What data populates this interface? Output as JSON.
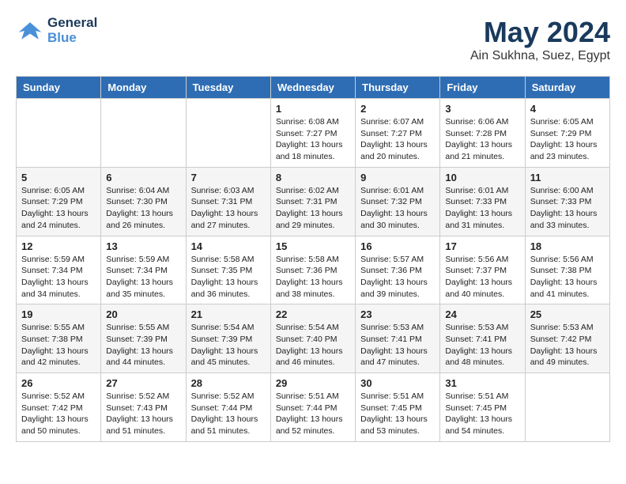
{
  "header": {
    "logo_general": "General",
    "logo_blue": "Blue",
    "title": "May 2024",
    "subtitle": "Ain Sukhna, Suez, Egypt"
  },
  "weekdays": [
    "Sunday",
    "Monday",
    "Tuesday",
    "Wednesday",
    "Thursday",
    "Friday",
    "Saturday"
  ],
  "weeks": [
    [
      {
        "day": "",
        "info": ""
      },
      {
        "day": "",
        "info": ""
      },
      {
        "day": "",
        "info": ""
      },
      {
        "day": "1",
        "info": "Sunrise: 6:08 AM\nSunset: 7:27 PM\nDaylight: 13 hours\nand 18 minutes."
      },
      {
        "day": "2",
        "info": "Sunrise: 6:07 AM\nSunset: 7:27 PM\nDaylight: 13 hours\nand 20 minutes."
      },
      {
        "day": "3",
        "info": "Sunrise: 6:06 AM\nSunset: 7:28 PM\nDaylight: 13 hours\nand 21 minutes."
      },
      {
        "day": "4",
        "info": "Sunrise: 6:05 AM\nSunset: 7:29 PM\nDaylight: 13 hours\nand 23 minutes."
      }
    ],
    [
      {
        "day": "5",
        "info": "Sunrise: 6:05 AM\nSunset: 7:29 PM\nDaylight: 13 hours\nand 24 minutes."
      },
      {
        "day": "6",
        "info": "Sunrise: 6:04 AM\nSunset: 7:30 PM\nDaylight: 13 hours\nand 26 minutes."
      },
      {
        "day": "7",
        "info": "Sunrise: 6:03 AM\nSunset: 7:31 PM\nDaylight: 13 hours\nand 27 minutes."
      },
      {
        "day": "8",
        "info": "Sunrise: 6:02 AM\nSunset: 7:31 PM\nDaylight: 13 hours\nand 29 minutes."
      },
      {
        "day": "9",
        "info": "Sunrise: 6:01 AM\nSunset: 7:32 PM\nDaylight: 13 hours\nand 30 minutes."
      },
      {
        "day": "10",
        "info": "Sunrise: 6:01 AM\nSunset: 7:33 PM\nDaylight: 13 hours\nand 31 minutes."
      },
      {
        "day": "11",
        "info": "Sunrise: 6:00 AM\nSunset: 7:33 PM\nDaylight: 13 hours\nand 33 minutes."
      }
    ],
    [
      {
        "day": "12",
        "info": "Sunrise: 5:59 AM\nSunset: 7:34 PM\nDaylight: 13 hours\nand 34 minutes."
      },
      {
        "day": "13",
        "info": "Sunrise: 5:59 AM\nSunset: 7:34 PM\nDaylight: 13 hours\nand 35 minutes."
      },
      {
        "day": "14",
        "info": "Sunrise: 5:58 AM\nSunset: 7:35 PM\nDaylight: 13 hours\nand 36 minutes."
      },
      {
        "day": "15",
        "info": "Sunrise: 5:58 AM\nSunset: 7:36 PM\nDaylight: 13 hours\nand 38 minutes."
      },
      {
        "day": "16",
        "info": "Sunrise: 5:57 AM\nSunset: 7:36 PM\nDaylight: 13 hours\nand 39 minutes."
      },
      {
        "day": "17",
        "info": "Sunrise: 5:56 AM\nSunset: 7:37 PM\nDaylight: 13 hours\nand 40 minutes."
      },
      {
        "day": "18",
        "info": "Sunrise: 5:56 AM\nSunset: 7:38 PM\nDaylight: 13 hours\nand 41 minutes."
      }
    ],
    [
      {
        "day": "19",
        "info": "Sunrise: 5:55 AM\nSunset: 7:38 PM\nDaylight: 13 hours\nand 42 minutes."
      },
      {
        "day": "20",
        "info": "Sunrise: 5:55 AM\nSunset: 7:39 PM\nDaylight: 13 hours\nand 44 minutes."
      },
      {
        "day": "21",
        "info": "Sunrise: 5:54 AM\nSunset: 7:39 PM\nDaylight: 13 hours\nand 45 minutes."
      },
      {
        "day": "22",
        "info": "Sunrise: 5:54 AM\nSunset: 7:40 PM\nDaylight: 13 hours\nand 46 minutes."
      },
      {
        "day": "23",
        "info": "Sunrise: 5:53 AM\nSunset: 7:41 PM\nDaylight: 13 hours\nand 47 minutes."
      },
      {
        "day": "24",
        "info": "Sunrise: 5:53 AM\nSunset: 7:41 PM\nDaylight: 13 hours\nand 48 minutes."
      },
      {
        "day": "25",
        "info": "Sunrise: 5:53 AM\nSunset: 7:42 PM\nDaylight: 13 hours\nand 49 minutes."
      }
    ],
    [
      {
        "day": "26",
        "info": "Sunrise: 5:52 AM\nSunset: 7:42 PM\nDaylight: 13 hours\nand 50 minutes."
      },
      {
        "day": "27",
        "info": "Sunrise: 5:52 AM\nSunset: 7:43 PM\nDaylight: 13 hours\nand 51 minutes."
      },
      {
        "day": "28",
        "info": "Sunrise: 5:52 AM\nSunset: 7:44 PM\nDaylight: 13 hours\nand 51 minutes."
      },
      {
        "day": "29",
        "info": "Sunrise: 5:51 AM\nSunset: 7:44 PM\nDaylight: 13 hours\nand 52 minutes."
      },
      {
        "day": "30",
        "info": "Sunrise: 5:51 AM\nSunset: 7:45 PM\nDaylight: 13 hours\nand 53 minutes."
      },
      {
        "day": "31",
        "info": "Sunrise: 5:51 AM\nSunset: 7:45 PM\nDaylight: 13 hours\nand 54 minutes."
      },
      {
        "day": "",
        "info": ""
      }
    ]
  ]
}
